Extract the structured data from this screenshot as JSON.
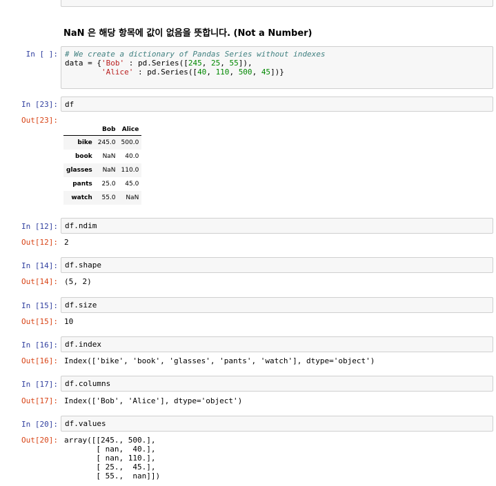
{
  "markdown": "NaN 은 해당 항목에 값이 없음을 뜻합니다. (Not a Number)",
  "cells": {
    "c1": {
      "in": "In [ ]:",
      "code_comment": "# We create a dictionary of Pandas Series without indexes",
      "l1a": "data = {",
      "l1s": "'Bob'",
      "l1b": " : pd.Series([",
      "l1n1": "245",
      "l1c1": ", ",
      "l1n2": "25",
      "l1c2": ", ",
      "l1n3": "55",
      "l1e": "]),",
      "l2a": "        ",
      "l2s": "'Alice'",
      "l2b": " : pd.Series([",
      "l2n1": "40",
      "l2c1": ", ",
      "l2n2": "110",
      "l2c2": ", ",
      "l2n3": "500",
      "l2c3": ", ",
      "l2n4": "45",
      "l2e": "])}"
    },
    "c23": {
      "in": "In [23]:",
      "code": "df",
      "out": "Out[23]:"
    },
    "c12": {
      "in": "In [12]:",
      "code": "df.ndim",
      "out": "Out[12]:",
      "result": "2"
    },
    "c14": {
      "in": "In [14]:",
      "code": "df.shape",
      "out": "Out[14]:",
      "result": "(5, 2)"
    },
    "c15": {
      "in": "In [15]:",
      "code": "df.size",
      "out": "Out[15]:",
      "result": "10"
    },
    "c16": {
      "in": "In [16]:",
      "code": "df.index",
      "out": "Out[16]:",
      "result": "Index(['bike', 'book', 'glasses', 'pants', 'watch'], dtype='object')"
    },
    "c17": {
      "in": "In [17]:",
      "code": "df.columns",
      "out": "Out[17]:",
      "result": "Index(['Bob', 'Alice'], dtype='object')"
    },
    "c20": {
      "in": "In [20]:",
      "code": "df.values",
      "out": "Out[20]:",
      "result": "array([[245., 500.],\n       [ nan,  40.],\n       [ nan, 110.],\n       [ 25.,  45.],\n       [ 55.,  nan]])"
    }
  },
  "dataframe": {
    "columns": [
      "Bob",
      "Alice"
    ],
    "rows": [
      {
        "index": "bike",
        "bob": "245.0",
        "alice": "500.0"
      },
      {
        "index": "book",
        "bob": "NaN",
        "alice": "40.0"
      },
      {
        "index": "glasses",
        "bob": "NaN",
        "alice": "110.0"
      },
      {
        "index": "pants",
        "bob": "25.0",
        "alice": "45.0"
      },
      {
        "index": "watch",
        "bob": "55.0",
        "alice": "NaN"
      }
    ]
  }
}
